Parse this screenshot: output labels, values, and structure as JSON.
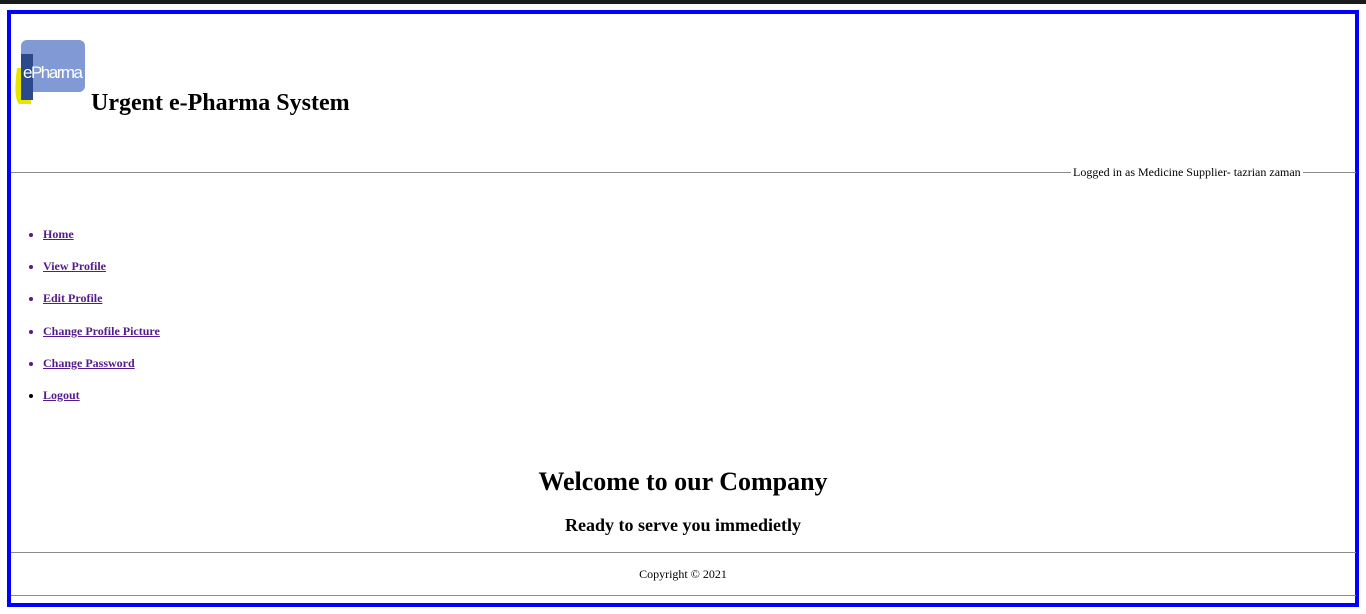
{
  "header": {
    "logo_text": "ePharma",
    "title": "Urgent e-Pharma System",
    "logged_in": "Logged in as Medicine Supplier- tazrian zaman"
  },
  "nav": {
    "items": [
      {
        "label": "Home"
      },
      {
        "label": "View Profile"
      },
      {
        "label": "Edit Profile"
      },
      {
        "label": "Change Profile Picture"
      },
      {
        "label": "Change Password"
      },
      {
        "label": "Logout"
      }
    ]
  },
  "main": {
    "heading": "Welcome to our Company",
    "subheading": "Ready to serve you immedietly"
  },
  "footer": {
    "copyright": "Copyright © 2021"
  },
  "colors": {
    "frame": "#0000ff",
    "link": "#551a8b"
  }
}
